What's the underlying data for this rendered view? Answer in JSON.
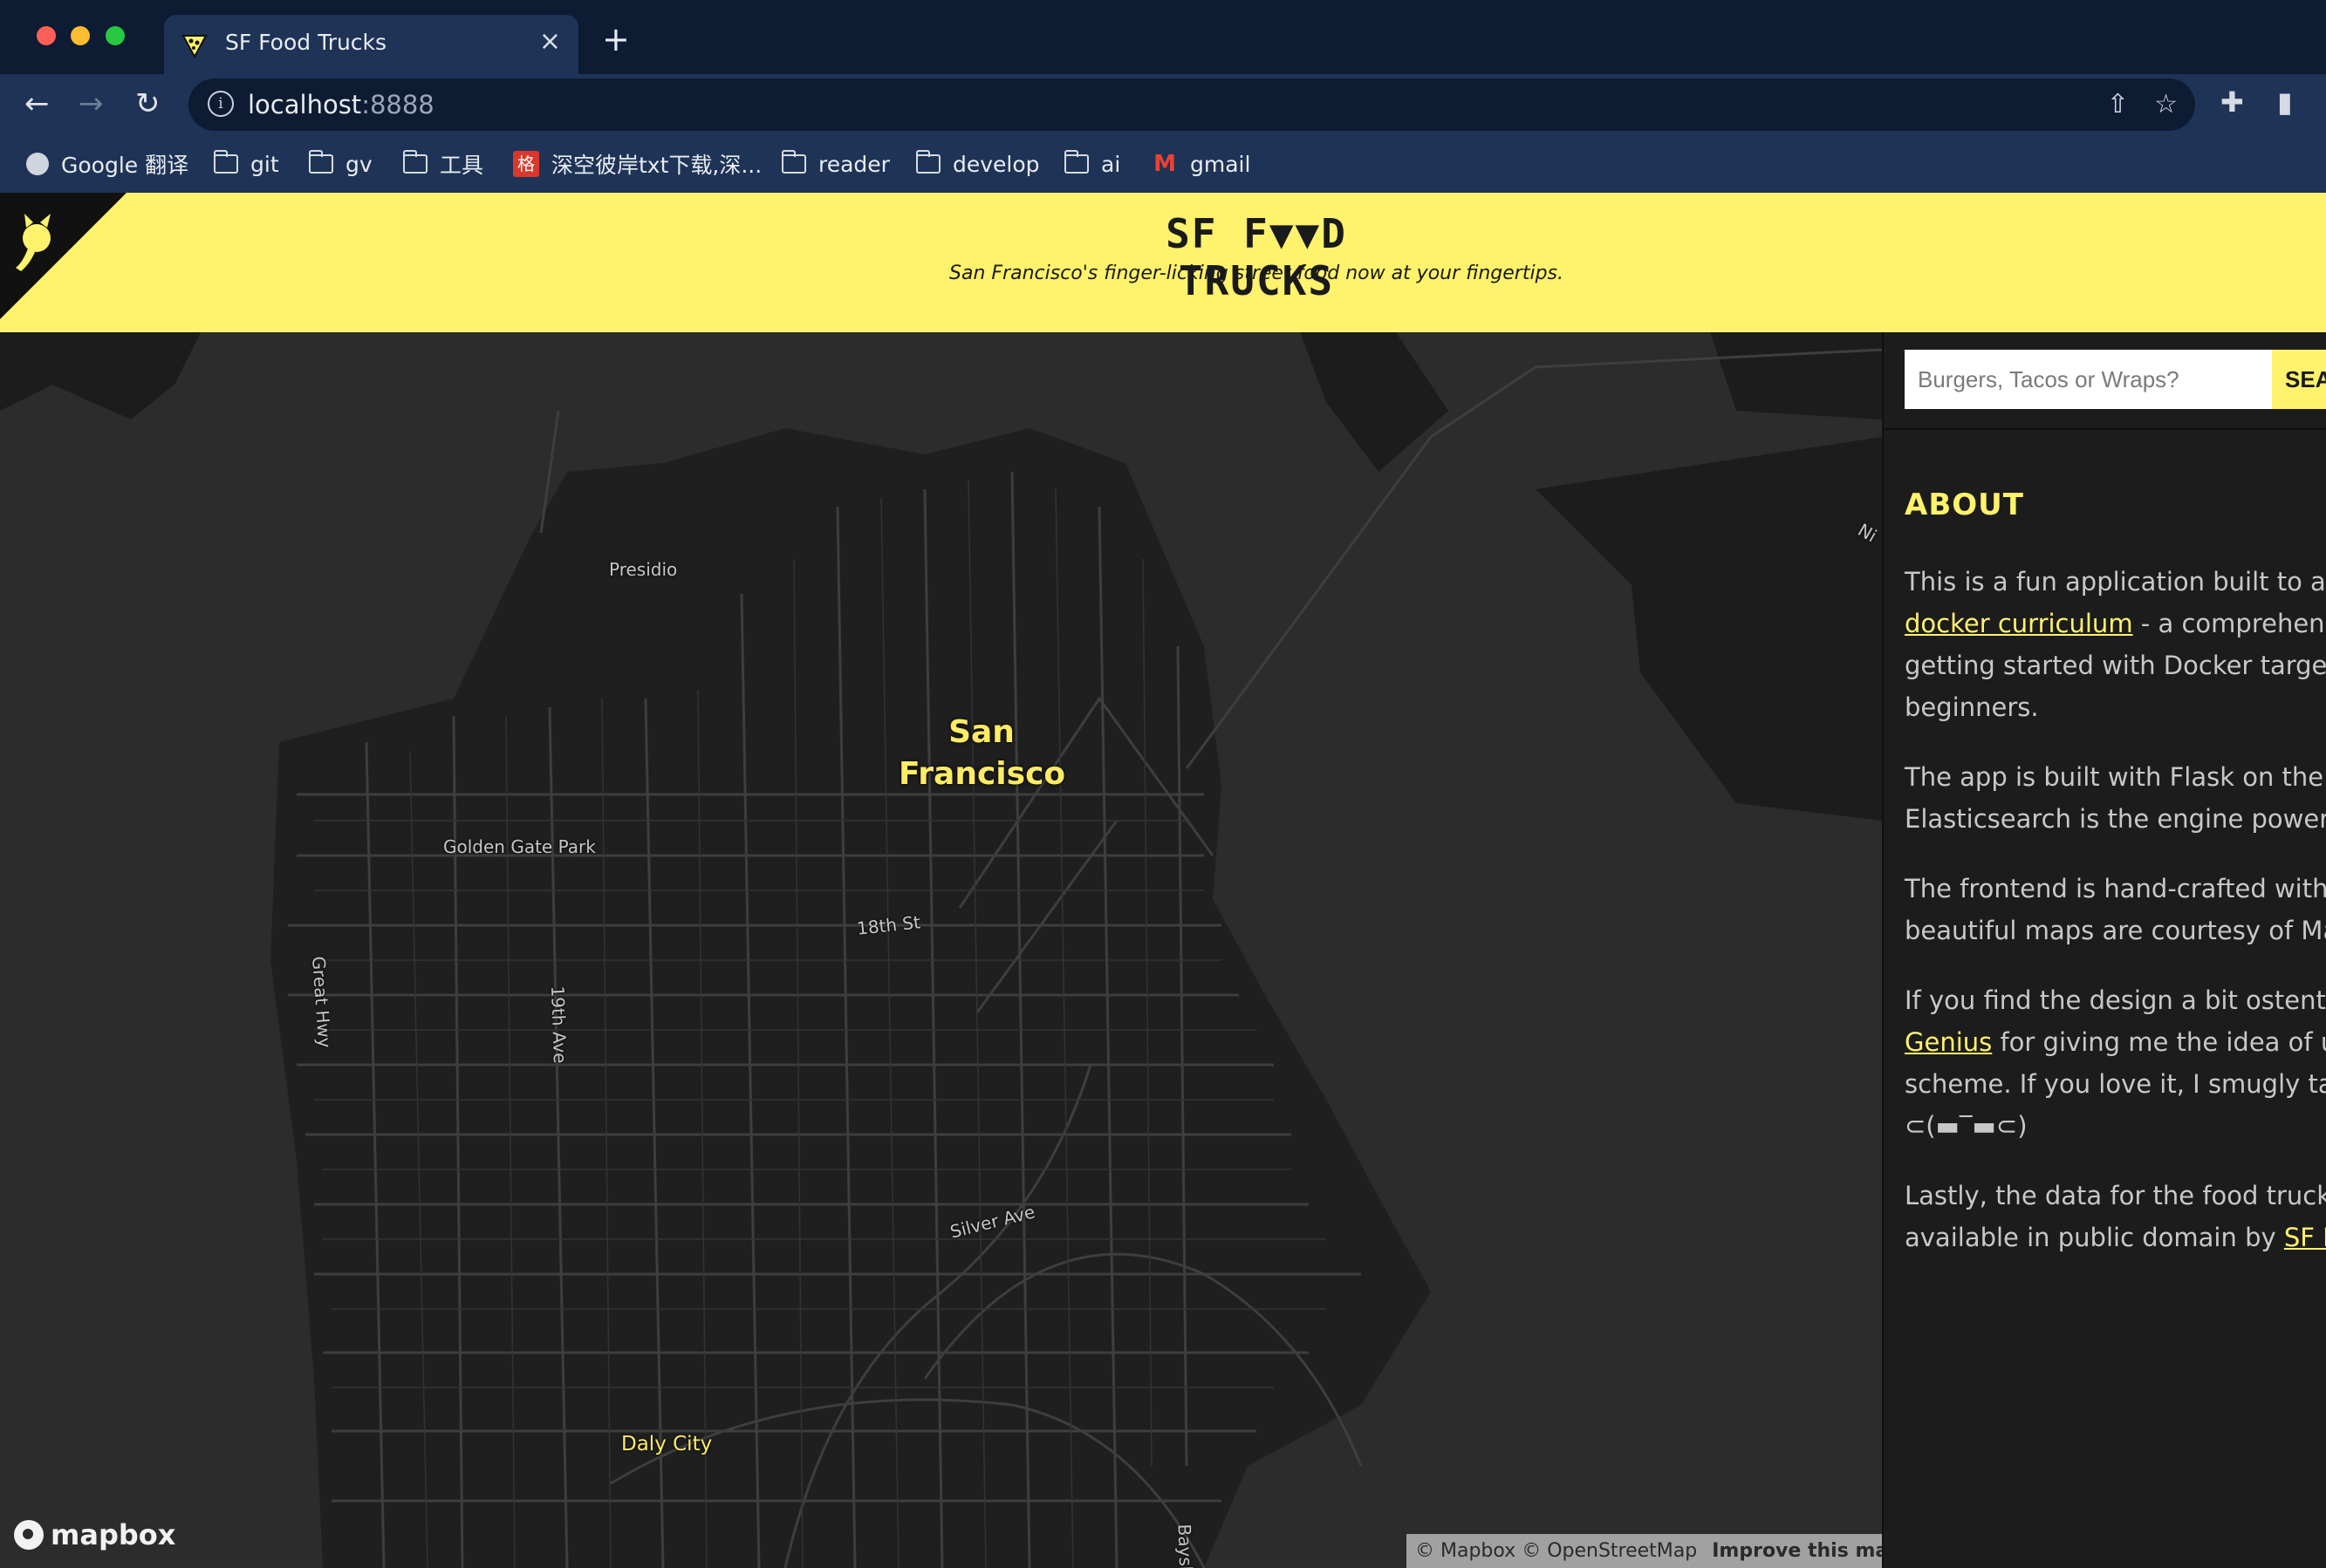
{
  "browser": {
    "tab_title": "SF Food Trucks",
    "url_host": "localhost",
    "url_port": ":8888",
    "bookmarks": [
      {
        "label": "Google 翻译",
        "icon": "globe-icon"
      },
      {
        "label": "git",
        "icon": "folder-icon"
      },
      {
        "label": "gv",
        "icon": "folder-icon"
      },
      {
        "label": "工具",
        "icon": "folder-icon"
      },
      {
        "label": "深空彼岸txt下载,深...",
        "icon": "site-icon",
        "icon_text": "格"
      },
      {
        "label": "reader",
        "icon": "folder-icon"
      },
      {
        "label": "develop",
        "icon": "folder-icon"
      },
      {
        "label": "ai",
        "icon": "folder-icon"
      },
      {
        "label": "gmail",
        "icon": "gmail-icon",
        "icon_text": "M"
      }
    ]
  },
  "header": {
    "logo": "SF F▼▼D TRUCKS",
    "tagline": "San Francisco's finger-licking street food now at your fingertips."
  },
  "map": {
    "city": "San Francisco",
    "labels": {
      "presidio": "Presidio",
      "golden_gate_park": "Golden Gate Park",
      "st18": "18th St",
      "great_hwy": "Great Hwy",
      "ave19": "19th Ave",
      "silver_ave": "Silver Ave",
      "daly_city": "Daly City",
      "bayshore": "Baysh",
      "ni": "Ni"
    },
    "logo": "mapbox",
    "attribution": {
      "mapbox": "© Mapbox",
      "osm": "© OpenStreetMap",
      "improve": "Improve this map"
    }
  },
  "sidebar": {
    "search_placeholder": "Burgers, Tacos or Wraps?",
    "search_button": "SEARCH",
    "about_title": "ABOUT",
    "p1": {
      "t1": "This is a fun application built to accompany the",
      "link": "docker curriculum",
      "t2": " - a comprehensive tutorial on",
      "t3": "getting started with Docker targeted especially at",
      "t4": "beginners."
    },
    "p2": {
      "t1": "The app is built with Flask on the backend and",
      "t2": "Elasticsearch is the engine powering the search."
    },
    "p3": {
      "t1": "The frontend is hand-crafted with React and the",
      "t2": "beautiful maps are courtesy of Mapbox."
    },
    "p4": {
      "t1": "If you find the design a bit ostentatious, blame",
      "link": "Genius",
      "t2": " for giving me the idea of using this color",
      "t3": "scheme. If you love it, I smugly take all the credit.",
      "t4": "⊂(▬‾▬⊂)"
    },
    "p5": {
      "t1": "Lastly, the data for the food trucks is made",
      "t2": "available in public domain by ",
      "link": "SF Data"
    }
  }
}
